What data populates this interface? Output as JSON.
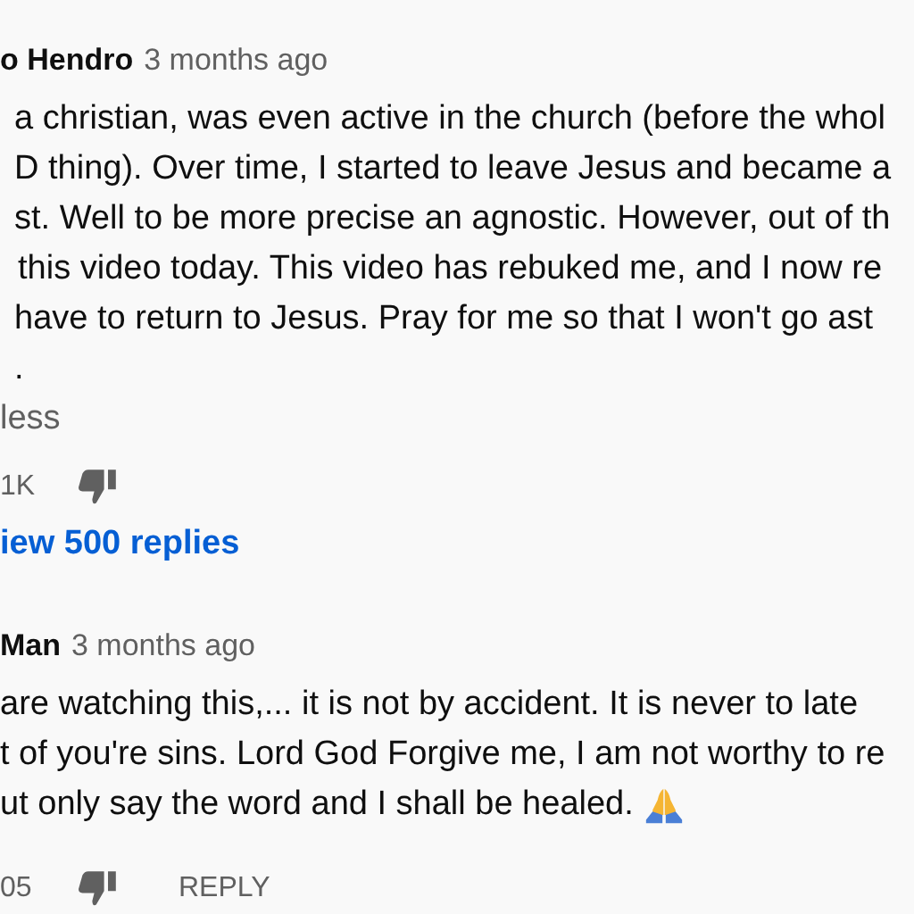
{
  "comments": [
    {
      "author": "o Hendro",
      "time": "3 months ago",
      "body_lines": [
        "a christian, was even active in the church (before the whol",
        "D thing). Over time, I started to leave Jesus and became a",
        "st. Well to be more precise an agnostic. However, out of th",
        "this video today. This video has rebuked me, and I now re",
        "have to return to Jesus. Pray for me so that I won't go ast",
        "."
      ],
      "emoji": false,
      "toggle": "less",
      "likes": "1K",
      "replies_link": "iew 500 replies"
    },
    {
      "author": "Man",
      "time": "3 months ago",
      "body_lines": [
        "are watching this,... it is not by accident. It is never to late",
        "t of you're sins. Lord God Forgive me, I am not worthy to re",
        "ut only say the word and I shall be healed."
      ],
      "emoji": true,
      "likes": "05",
      "reply_button": "REPLY"
    }
  ]
}
